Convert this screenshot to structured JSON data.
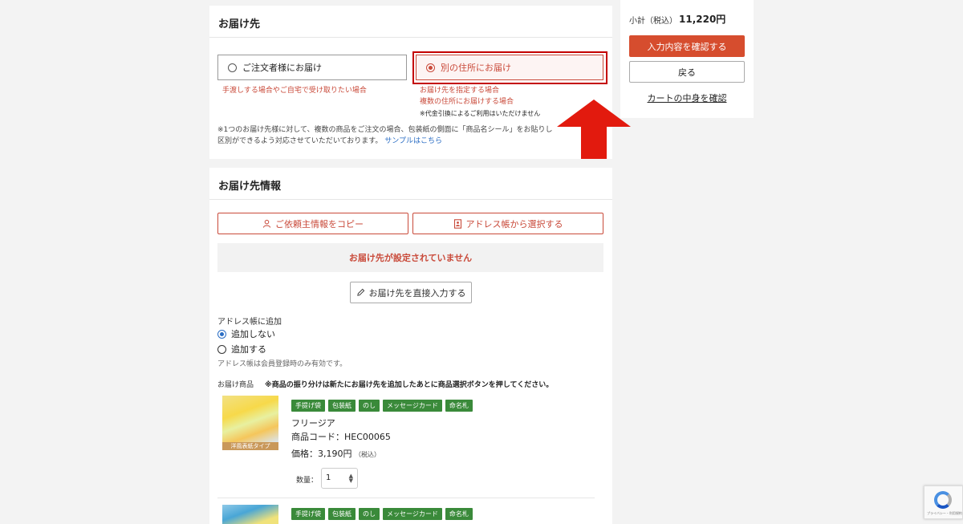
{
  "delivery": {
    "title": "お届け先",
    "option_self": "ご注文者様にお届け",
    "option_other": "別の住所にお届け",
    "note_self": "手渡しする場合やご自宅で受け取りたい場合",
    "note_other_1": "お届け先を指定する場合",
    "note_other_2": "複数の住所にお届けする場合",
    "note_other_3": "※代金引換によるご利用はいただけません",
    "small_text": "※1つのお届け先様に対して、複数の商品をご注文の場合、包装紙の側面に「商品名シール」をお貼りし",
    "small_text_2": "区別ができるよう対応させていただいております。",
    "sample_link": "サンプルはこちら"
  },
  "info": {
    "title": "お届け先情報",
    "copy_btn": "ご依頼主情報をコピー",
    "addr_btn": "アドレス帳から選択する",
    "no_dest": "お届け先が設定されていません",
    "direct_btn": "お届け先を直接入力する",
    "addr_add_label": "アドレス帳に追加",
    "radio_no": "追加しない",
    "radio_yes": "追加する",
    "addr_hint": "アドレス帳は会員登録時のみ有効です。",
    "goods_label": "お届け商品",
    "goods_note": "※商品の振り分けは新たにお届け先を追加したあとに商品選択ボタンを押してください。"
  },
  "products": [
    {
      "tags": [
        "手提げ袋",
        "包装紙",
        "のし",
        "メッセージカード",
        "命名札"
      ],
      "thumb_tag": "洋風表紙タイプ",
      "name": "フリージア",
      "code": "商品コード：HEC00065",
      "price": "価格：3,190円",
      "tax": "（税込）",
      "qty_label": "数量：",
      "qty_value": "1"
    },
    {
      "tags": [
        "手提げ袋",
        "包装紙",
        "のし",
        "メッセージカード",
        "命名札"
      ]
    }
  ],
  "summary": {
    "subtotal_label": "小計（税込）",
    "subtotal_value": "11,220円",
    "confirm_btn": "入力内容を確認する",
    "back_btn": "戻る",
    "cart_link": "カートの中身を確認"
  },
  "recaptcha": {
    "text": "プライバシー・利用規約"
  },
  "colors": {
    "accent": "#d64d2e",
    "highlight": "#c40000",
    "tag_green": "#3a8a3a",
    "link": "#2a6dc4"
  }
}
